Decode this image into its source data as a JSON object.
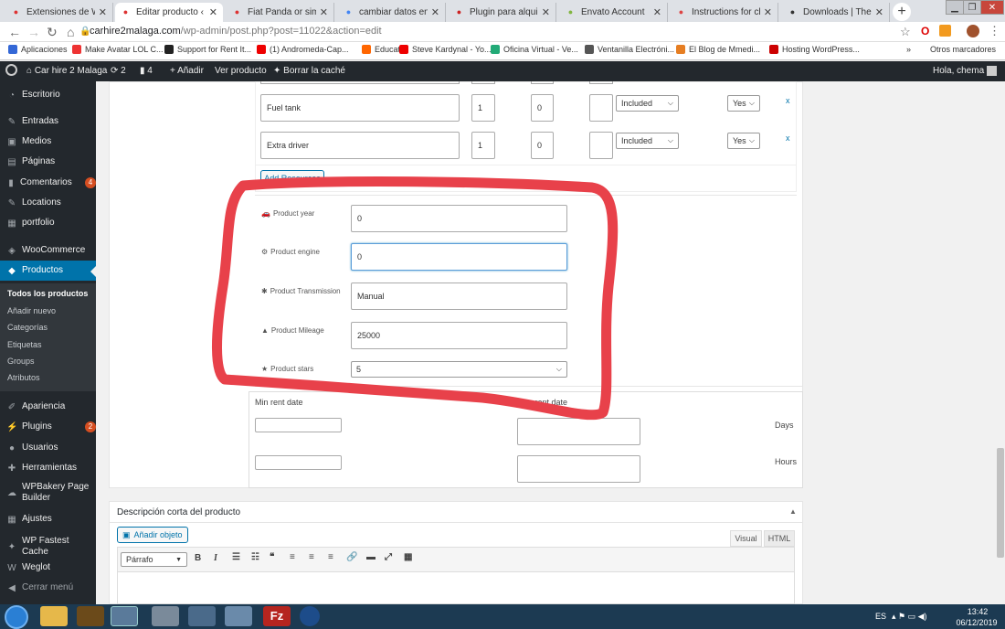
{
  "browser": {
    "tabs": [
      {
        "title": "Extensiones de WooCo",
        "favicon": "wp-red"
      },
      {
        "title": "Editar producto ‹ Car h",
        "favicon": "wp-red"
      },
      {
        "title": "Fiat Panda or similar –",
        "favicon": "wp-red"
      },
      {
        "title": "cambiar datos en coch",
        "favicon": "google"
      },
      {
        "title": "Plugin para alquiler ve",
        "favicon": "woo"
      },
      {
        "title": "Envato Account",
        "favicon": "envato"
      },
      {
        "title": "Instructions for chang",
        "favicon": "gmail"
      },
      {
        "title": "Downloads | ThemeFo",
        "favicon": "themeforest"
      }
    ],
    "active_tab": 1,
    "url_host": "carhire2malaga.com",
    "url_path": "/wp-admin/post.php?post=11022&action=edit",
    "bookmarks": [
      "Aplicaciones",
      "Make Avatar LOL C...",
      "Support for Rent It...",
      "(1) Andromeda-Cap...",
      "Educatic",
      "Steve Kardynal - Yo...",
      "Oficina Virtual - Ve...",
      "Ventanilla Electróni...",
      "El Blog de Mmedi...",
      "Hosting WordPress...",
      "»",
      "Otros marcadores"
    ]
  },
  "adminbar": {
    "site": "Car hire 2 Malaga",
    "updates": "2",
    "comments": "4",
    "add_new": "Añadir",
    "view_product": "Ver producto",
    "clear_cache": "Borrar la caché",
    "greeting": "Hola, chema"
  },
  "sidebar": {
    "items": [
      {
        "label": "Escritorio",
        "icon": "dashboard-icon"
      },
      {
        "label": "Entradas",
        "icon": "pin-icon"
      },
      {
        "label": "Medios",
        "icon": "media-icon"
      },
      {
        "label": "Páginas",
        "icon": "page-icon"
      },
      {
        "label": "Comentarios",
        "icon": "comment-icon",
        "badge": "4"
      },
      {
        "label": "Locations",
        "icon": "pin-icon"
      },
      {
        "label": "portfolio",
        "icon": "portfolio-icon"
      },
      {
        "label": "WooCommerce",
        "icon": "woo-icon"
      },
      {
        "label": "Productos",
        "icon": "product-icon"
      },
      {
        "label": "Apariencia",
        "icon": "brush-icon"
      },
      {
        "label": "Plugins",
        "icon": "plugin-icon",
        "badge": "2"
      },
      {
        "label": "Usuarios",
        "icon": "user-icon"
      },
      {
        "label": "Herramientas",
        "icon": "wrench-icon"
      },
      {
        "label": "WPBakery Page Builder",
        "icon": "wpbakery-icon"
      },
      {
        "label": "Ajustes",
        "icon": "settings-icon"
      },
      {
        "label": "WP Fastest Cache",
        "icon": "cache-icon"
      },
      {
        "label": "Weglot",
        "icon": "weglot-icon"
      },
      {
        "label": "Cerrar menú",
        "icon": "collapse-icon"
      }
    ],
    "submenu": [
      "Todos los productos",
      "Añadir nuevo",
      "Categorías",
      "Etiquetas",
      "Groups",
      "Atributos"
    ]
  },
  "resources": {
    "rows": [
      {
        "name": "Fuel tank",
        "qty": "1",
        "price": "0",
        "extra": "",
        "type": "Included",
        "active": "Yes",
        "remove": "x"
      },
      {
        "name": "Extra driver",
        "qty": "1",
        "price": "0",
        "extra": "",
        "type": "Included",
        "active": "Yes",
        "remove": "x"
      }
    ],
    "add_button": "Add Resources"
  },
  "product_fields": [
    {
      "label": "Product year",
      "icon": "car-icon",
      "value": "0"
    },
    {
      "label": "Product engine",
      "icon": "engine-icon",
      "value": "0"
    },
    {
      "label": "Product Transmission",
      "icon": "gear-icon",
      "value": "Manual"
    },
    {
      "label": "Product Mileage",
      "icon": "road-icon",
      "value": "25000"
    }
  ],
  "product_stars": {
    "label": "Product stars",
    "value": "5"
  },
  "rent_dates": {
    "min_label": "Min rent date",
    "max_label": "Max rent date",
    "days": "Days",
    "hours": "Hours"
  },
  "short_desc": {
    "title": "Descripción corta del producto",
    "add_media": "Añadir objeto",
    "tab_visual": "Visual",
    "tab_html": "HTML",
    "format": "Párrafo"
  },
  "taskbar": {
    "lang": "ES",
    "time": "13:42",
    "date": "06/12/2019"
  },
  "colors": {
    "annotation": "#e8414a",
    "wp_blue": "#0073aa",
    "admin_dark": "#23282d"
  }
}
